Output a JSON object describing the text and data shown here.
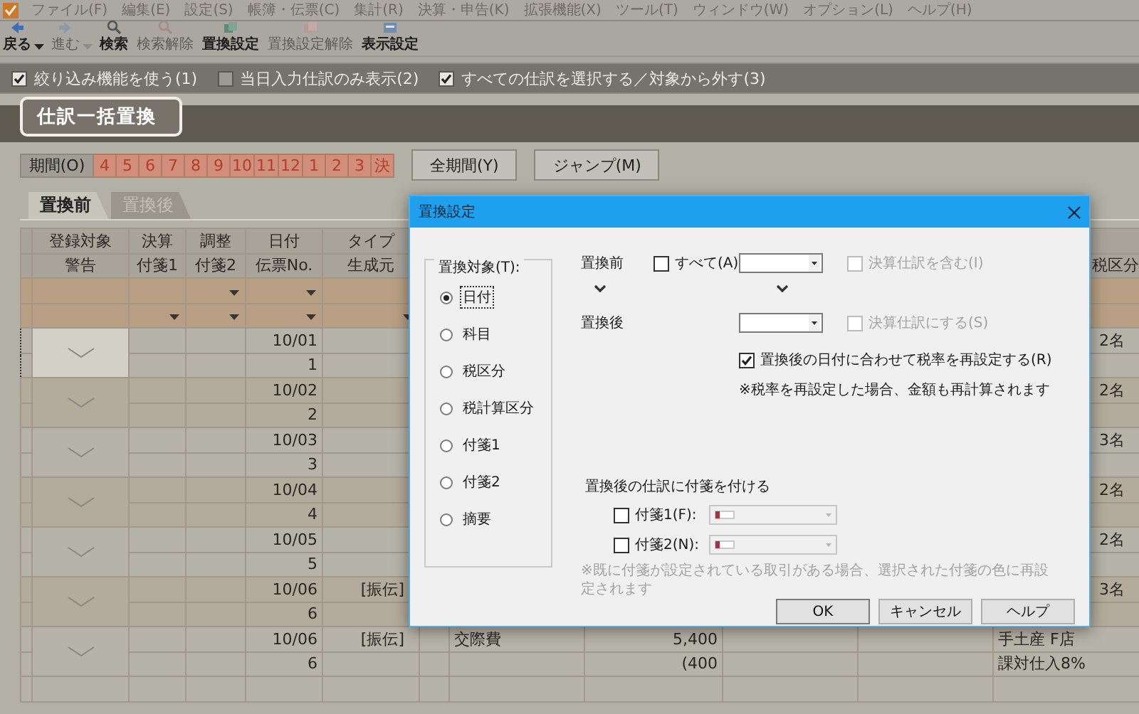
{
  "menu_bar": {
    "items": [
      "ファイル(F)",
      "編集(E)",
      "設定(S)",
      "帳簿・伝票(C)",
      "集計(R)",
      "決算・申告(K)",
      "拡張機能(X)",
      "ツール(T)",
      "ウィンドウ(W)",
      "オプション(L)",
      "ヘルプ(H)"
    ]
  },
  "toolbar": {
    "items": [
      {
        "kind": "back",
        "label": "戻る",
        "disabled": false,
        "has_menu": true
      },
      {
        "kind": "forward",
        "label": "進む",
        "disabled": true,
        "has_menu": true
      },
      {
        "kind": "search",
        "label": "検索",
        "disabled": false,
        "has_menu": false
      },
      {
        "kind": "search_clear",
        "label": "検索解除",
        "disabled": true,
        "has_menu": false
      },
      {
        "kind": "replace",
        "label": "置換設定",
        "disabled": false,
        "has_menu": false
      },
      {
        "kind": "replace_clear",
        "label": "置換設定解除",
        "disabled": true,
        "has_menu": false
      },
      {
        "kind": "view",
        "label": "表示設定",
        "disabled": false,
        "has_menu": false
      }
    ]
  },
  "filter_bar": {
    "options": [
      {
        "label": "絞り込み機能を使う(1)",
        "checked": true
      },
      {
        "label": "当日入力仕訳のみ表示(2)",
        "checked": false
      },
      {
        "label": "すべての仕訳を選択する／対象から外す(3)",
        "checked": true
      }
    ]
  },
  "page_title": "仕訳一括置換",
  "period_bar": {
    "label": "期間(O)",
    "months": [
      "4",
      "5",
      "6",
      "7",
      "8",
      "9",
      "10",
      "11",
      "12",
      "1",
      "2",
      "3",
      "決"
    ],
    "buttons": [
      "全期間(Y)",
      "ジャンプ(M)"
    ]
  },
  "tabs": [
    {
      "label": "置換前",
      "selected": true
    },
    {
      "label": "置換後",
      "selected": false
    }
  ],
  "table": {
    "columns": [
      {
        "top": "登録対象",
        "bottom": "警告"
      },
      {
        "top": "決算",
        "bottom": "付箋1"
      },
      {
        "top": "調整",
        "bottom": "付箋2"
      },
      {
        "top": "日付",
        "bottom": "伝票No."
      },
      {
        "top": "タイプ",
        "bottom": "生成元"
      },
      {
        "bottom": "税区分"
      }
    ],
    "rows": [
      {
        "selected": true,
        "registered": true,
        "date": "10/01",
        "slip_no": "1",
        "memo_end": "2名"
      },
      {
        "selected": false,
        "registered": true,
        "date": "10/02",
        "slip_no": "2",
        "memo_end": "2名"
      },
      {
        "selected": false,
        "registered": true,
        "date": "10/03",
        "slip_no": "3",
        "memo_end": "3名"
      },
      {
        "selected": false,
        "registered": true,
        "date": "10/04",
        "slip_no": "4",
        "memo_end": "2名"
      },
      {
        "selected": false,
        "registered": true,
        "date": "10/05",
        "slip_no": "5",
        "memo_end": "2名"
      },
      {
        "selected": false,
        "registered": true,
        "date": "10/06",
        "slip_no": "6",
        "type": "[振伝]",
        "memo_end": "3名"
      },
      {
        "selected": false,
        "registered": true,
        "date": "10/06",
        "slip_no": "6",
        "type": "[振伝]",
        "account": "交際費",
        "amount": "5,400",
        "tax": "(400",
        "memo": "手土産 F店",
        "memo_2": "課対仕入8%"
      }
    ]
  },
  "dialog": {
    "title": "置換設定",
    "target_group": {
      "label": "置換対象(T):",
      "options": [
        {
          "label": "日付",
          "selected": true
        },
        {
          "label": "科目",
          "selected": false
        },
        {
          "label": "税区分",
          "selected": false
        },
        {
          "label": "税計算区分",
          "selected": false
        },
        {
          "label": "付箋1",
          "selected": false
        },
        {
          "label": "付箋2",
          "selected": false
        },
        {
          "label": "摘要",
          "selected": false
        }
      ]
    },
    "before": {
      "label": "置換前",
      "all": {
        "label": "すべて(A)",
        "checked": false
      },
      "option": {
        "label": "決算仕訳を含む(I)",
        "checked": false,
        "disabled": true
      }
    },
    "after": {
      "label": "置換後",
      "option": {
        "label": "決算仕訳にする(S)",
        "checked": false,
        "disabled": true
      },
      "reset_tax": {
        "label": "置換後の日付に合わせて税率を再設定する(R)",
        "checked": true,
        "disabled": false
      },
      "note": "※税率を再設定した場合、金額も再計算されます"
    },
    "tags": {
      "heading": "置換後の仕訳に付箋を付ける",
      "items": [
        {
          "label": "付箋1(F):",
          "checked": false
        },
        {
          "label": "付箋2(N):",
          "checked": false
        }
      ],
      "note": "※既に付箋が設定されている取引がある場合、選択された付箋の色に再設定されます"
    },
    "buttons": [
      "OK",
      "キャンセル",
      "ヘルプ"
    ]
  }
}
